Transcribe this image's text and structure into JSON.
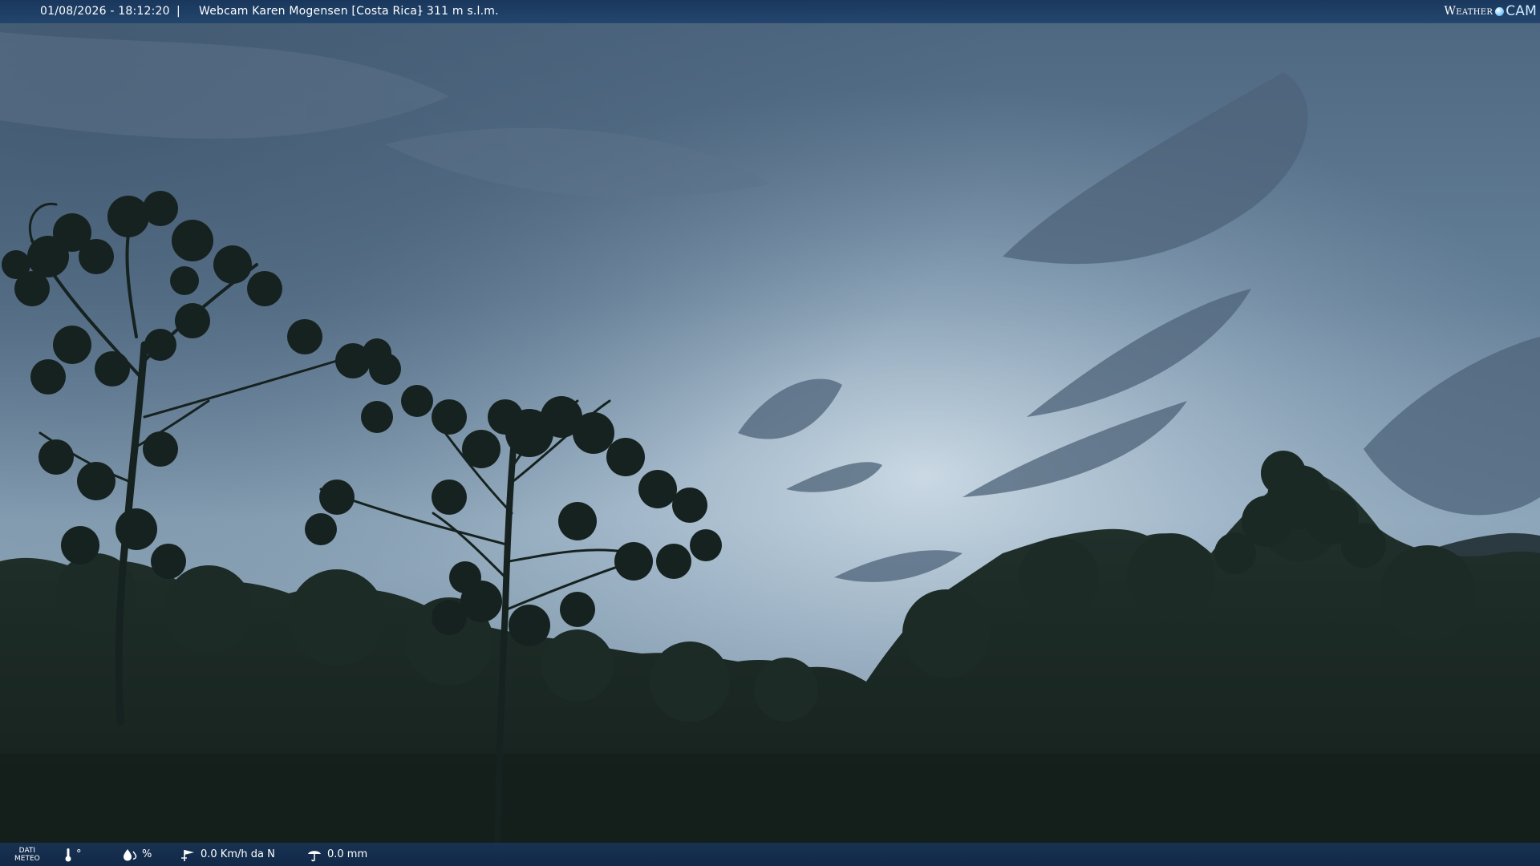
{
  "header": {
    "datetime": "01/08/2026 - 18:12:20",
    "separator": "|",
    "title": "Webcam Karen Mogensen [Costa Rica]",
    "elevation": "- 311 m s.l.m."
  },
  "logo": {
    "word": "Weather",
    "suffix": "CAM"
  },
  "footer": {
    "dati_line1": "DATI",
    "dati_line2": "METEO",
    "temperature": "°",
    "humidity": "%",
    "wind": "0.0 Km/h da N",
    "rain": "0.0 mm"
  },
  "icons": {
    "temperature": "thermometer-icon",
    "humidity": "humidity-icon",
    "wind": "wind-icon",
    "rain": "rain-icon"
  },
  "colors": {
    "bar": "#1e426c",
    "sky_top": "#4f6a84",
    "sky_bright": "#b9cddb",
    "canopy": "#1a2a24"
  }
}
